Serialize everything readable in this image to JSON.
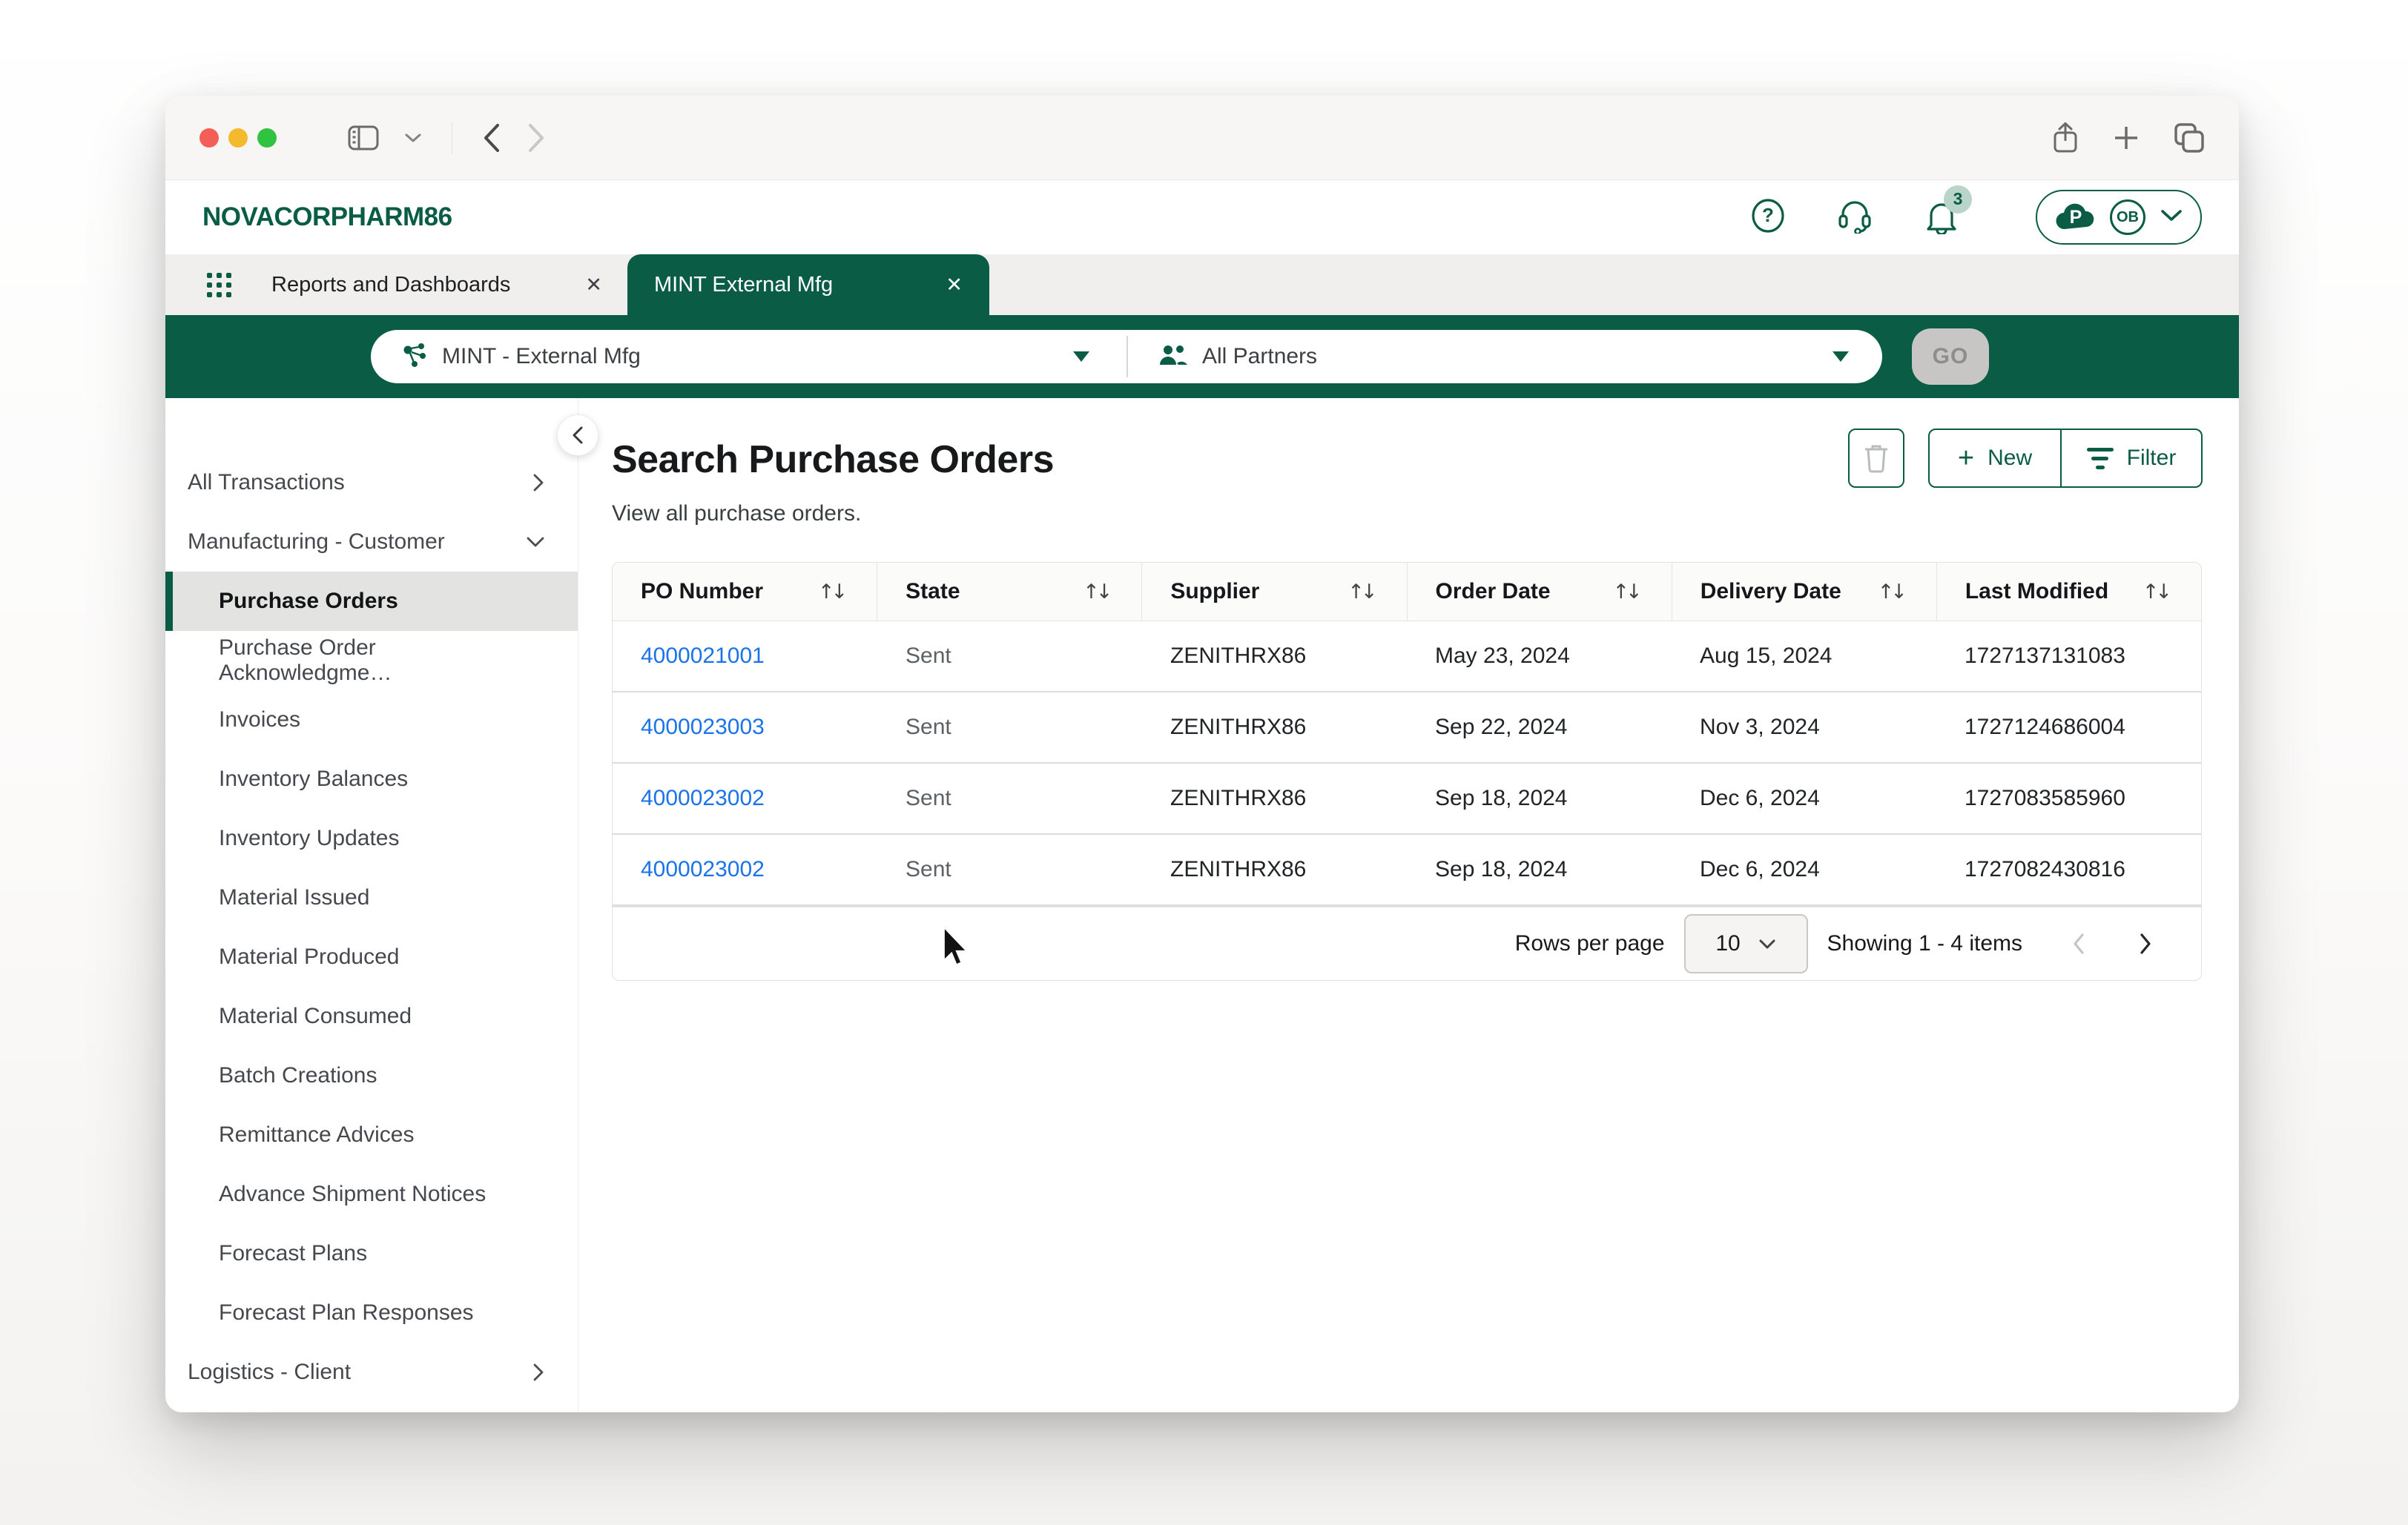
{
  "colors": {
    "brand_green": "#0a5c45",
    "badge_bg": "#b9d5c9",
    "link_blue": "#1a73e8",
    "selected_item_bg": "#e3e3e2",
    "go_disabled_bg": "#c7c6c4",
    "state_text_gray": "#5c6165"
  },
  "app_header": {
    "brand": "NOVACORPHARM86",
    "notification_count": "3",
    "cloud_logo_letter": "P",
    "avatar_initials": "OB"
  },
  "tab_bar": {
    "tabs": [
      {
        "label": "Reports and Dashboards",
        "active": false
      },
      {
        "label": "MINT External Mfg",
        "active": true
      }
    ],
    "close_glyph": "✕"
  },
  "toolbar": {
    "network_value": "MINT - External Mfg",
    "partners_value": "All Partners",
    "go_label": "GO"
  },
  "sidebar": {
    "items": [
      {
        "label": "All Transactions",
        "level": "top",
        "chevron": "right",
        "selected": false
      },
      {
        "label": "Manufacturing - Customer",
        "level": "top",
        "chevron": "down",
        "selected": false
      },
      {
        "label": "Purchase Orders",
        "level": "sub",
        "chevron": "none",
        "selected": true
      },
      {
        "label": "Purchase Order Acknowledgme…",
        "level": "sub",
        "chevron": "none",
        "selected": false
      },
      {
        "label": "Invoices",
        "level": "sub",
        "chevron": "none",
        "selected": false
      },
      {
        "label": "Inventory Balances",
        "level": "sub",
        "chevron": "none",
        "selected": false
      },
      {
        "label": "Inventory Updates",
        "level": "sub",
        "chevron": "none",
        "selected": false
      },
      {
        "label": "Material Issued",
        "level": "sub",
        "chevron": "none",
        "selected": false
      },
      {
        "label": "Material Produced",
        "level": "sub",
        "chevron": "none",
        "selected": false
      },
      {
        "label": "Material Consumed",
        "level": "sub",
        "chevron": "none",
        "selected": false
      },
      {
        "label": "Batch Creations",
        "level": "sub",
        "chevron": "none",
        "selected": false
      },
      {
        "label": "Remittance Advices",
        "level": "sub",
        "chevron": "none",
        "selected": false
      },
      {
        "label": "Advance Shipment Notices",
        "level": "sub",
        "chevron": "none",
        "selected": false
      },
      {
        "label": "Forecast Plans",
        "level": "sub",
        "chevron": "none",
        "selected": false
      },
      {
        "label": "Forecast Plan Responses",
        "level": "sub",
        "chevron": "none",
        "selected": false
      },
      {
        "label": "Logistics - Client",
        "level": "top",
        "chevron": "right",
        "selected": false
      }
    ]
  },
  "main": {
    "title": "Search Purchase Orders",
    "subtitle": "View all purchase orders.",
    "actions": {
      "new_label": "New",
      "filter_label": "Filter"
    },
    "table": {
      "columns": [
        "PO Number",
        "State",
        "Supplier",
        "Order Date",
        "Delivery Date",
        "Last Modified"
      ],
      "rows": [
        [
          "4000021001",
          "Sent",
          "ZENITHRX86",
          "May 23, 2024",
          "Aug 15, 2024",
          "1727137131083"
        ],
        [
          "4000023003",
          "Sent",
          "ZENITHRX86",
          "Sep 22, 2024",
          "Nov 3, 2024",
          "1727124686004"
        ],
        [
          "4000023002",
          "Sent",
          "ZENITHRX86",
          "Sep 18, 2024",
          "Dec 6, 2024",
          "1727083585960"
        ],
        [
          "4000023002",
          "Sent",
          "ZENITHRX86",
          "Sep 18, 2024",
          "Dec 6, 2024",
          "1727082430816"
        ]
      ],
      "pagination": {
        "rows_per_page_label": "Rows per page",
        "rows_per_page_value": "10",
        "showing_text": "Showing 1 - 4 items"
      }
    }
  }
}
